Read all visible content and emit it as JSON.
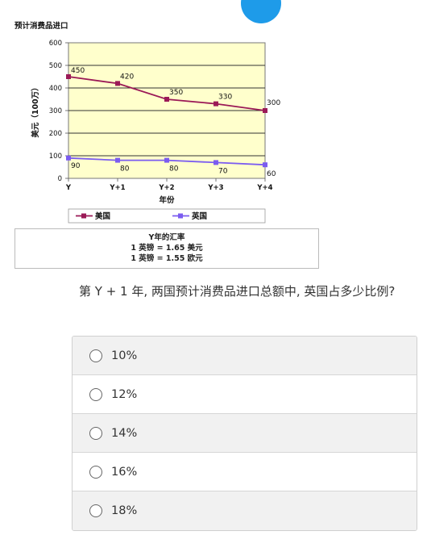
{
  "chart_data": {
    "type": "line",
    "title": "预计消费品进口",
    "xlabel": "年份",
    "ylabel": "美元（100万）",
    "categories": [
      "Y",
      "Y+1",
      "Y+2",
      "Y+3",
      "Y+4"
    ],
    "ylim": [
      0,
      600
    ],
    "yticks": [
      0,
      100,
      200,
      300,
      400,
      500,
      600
    ],
    "grid": true,
    "legend_position": "bottom",
    "series": [
      {
        "name": "美国",
        "values": [
          450,
          420,
          350,
          330,
          300
        ],
        "color": "#9b1a57"
      },
      {
        "name": "英国",
        "values": [
          90,
          80,
          80,
          70,
          60
        ],
        "color": "#7b5cf0"
      }
    ],
    "plot_background": "#ffffcc"
  },
  "exchange": {
    "title": "Y年的汇率",
    "line1": "1 英镑 = 1.65 美元",
    "line2": "1 英镑 = 1.55 欧元"
  },
  "question": {
    "text": "第 Y + 1 年, 两国预计消费品进口总额中, 英国占多少比例?",
    "options": [
      "10%",
      "12%",
      "14%",
      "16%",
      "18%"
    ]
  },
  "colors": {
    "accent_circle": "#1e9be9"
  }
}
